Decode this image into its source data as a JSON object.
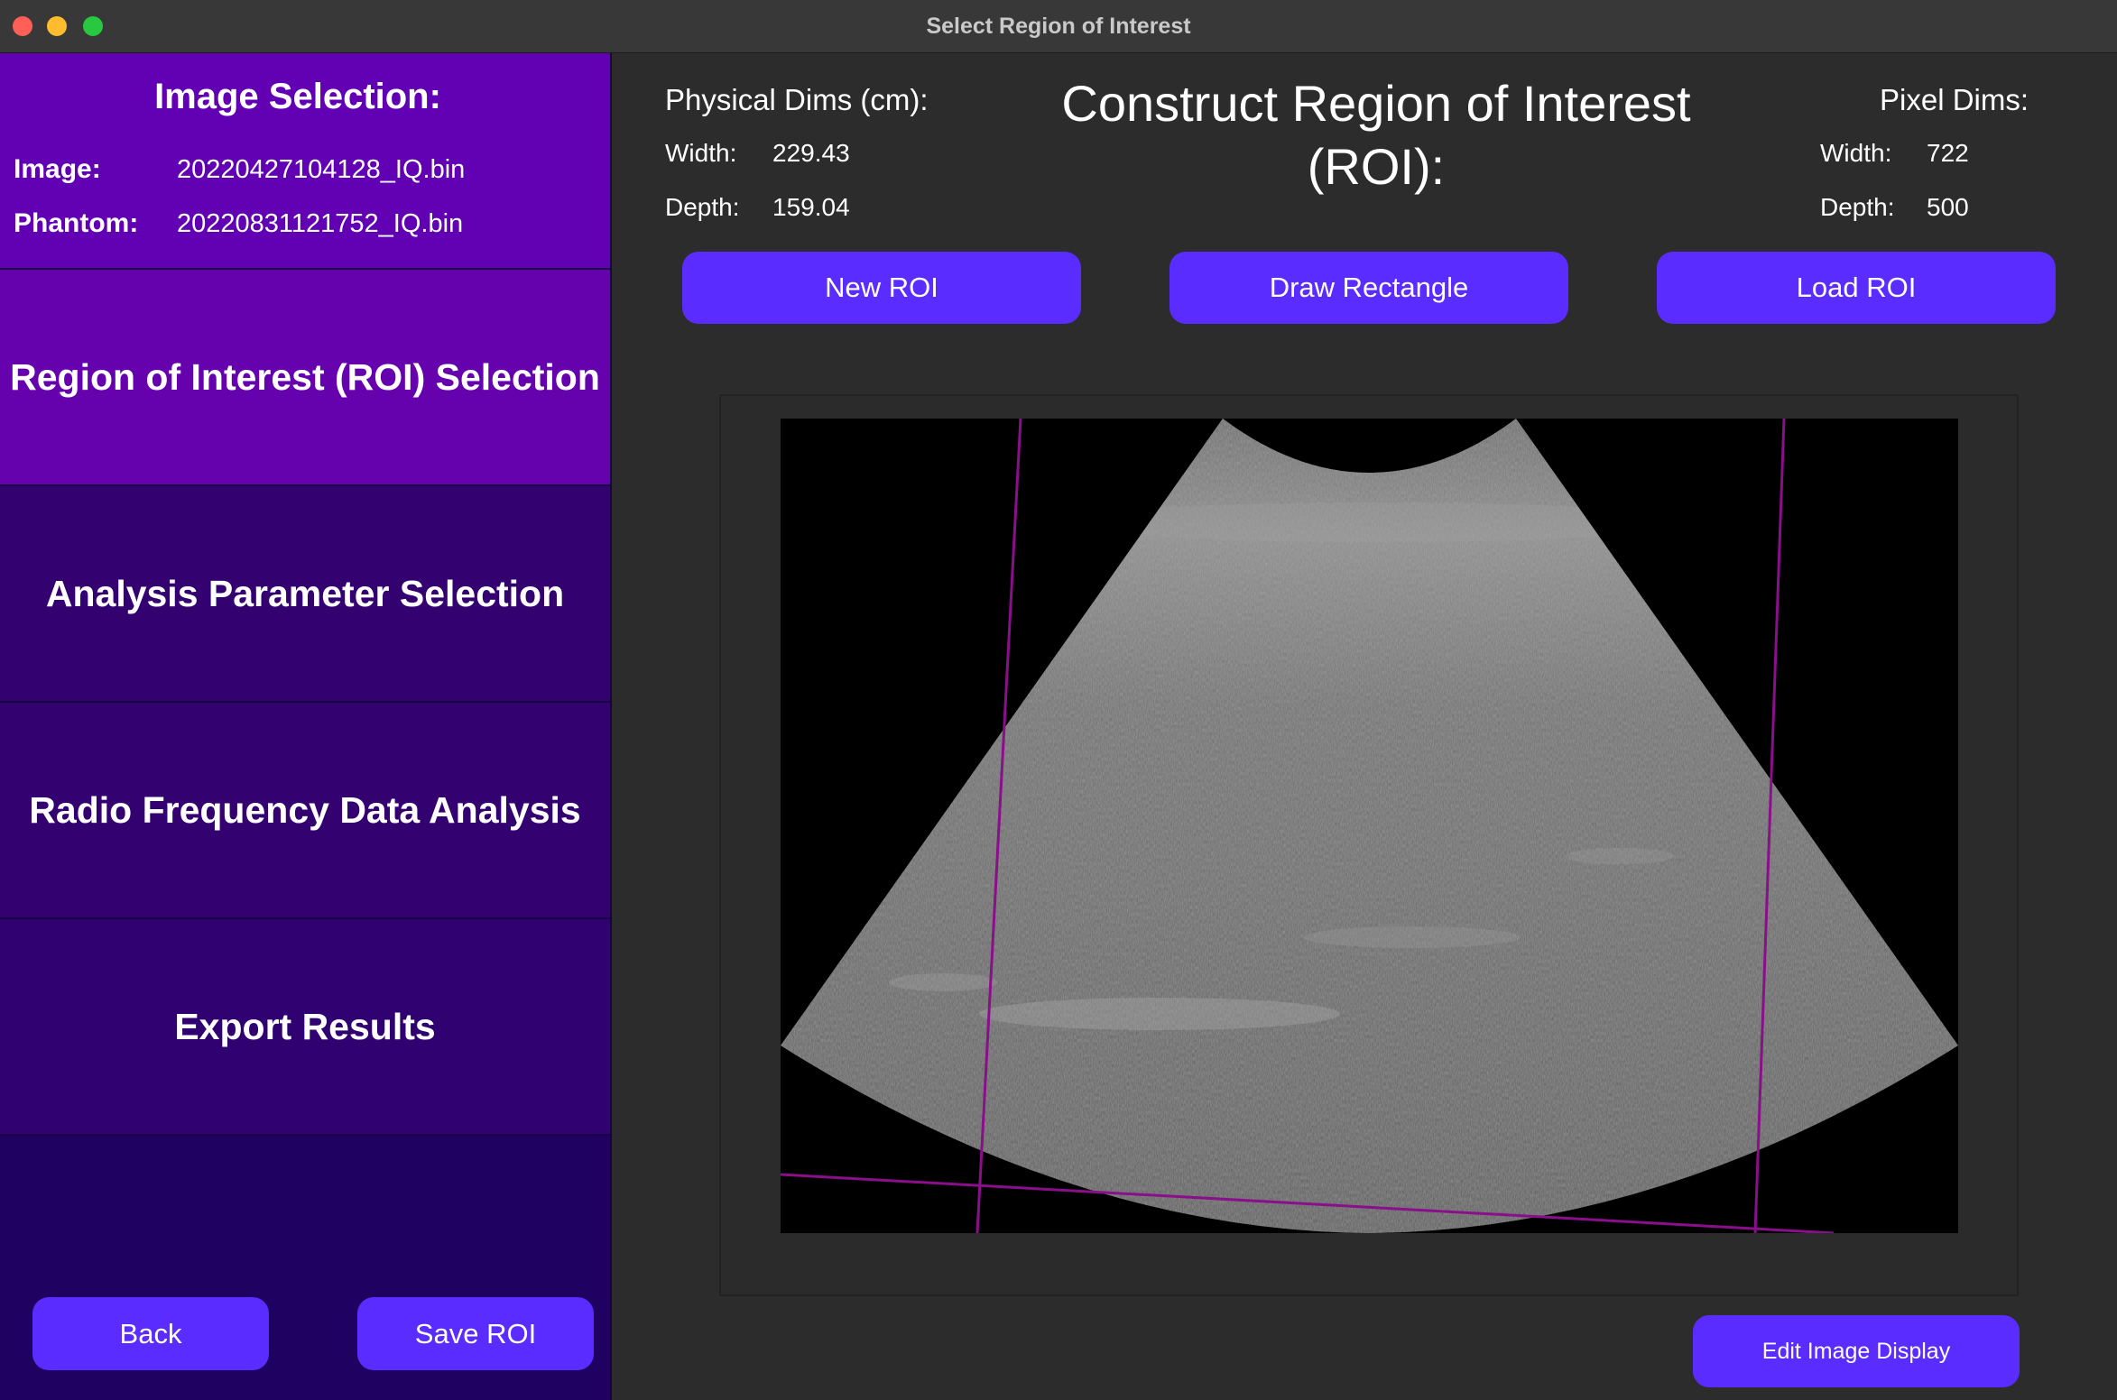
{
  "window": {
    "title": "Select Region of Interest"
  },
  "sidebar": {
    "image_selection": {
      "title": "Image Selection:",
      "image_label": "Image:",
      "image_value": "20220427104128_IQ.bin",
      "phantom_label": "Phantom:",
      "phantom_value": "20220831121752_IQ.bin"
    },
    "nav": [
      {
        "label": "Region of Interest (ROI) Selection"
      },
      {
        "label": "Analysis Parameter Selection"
      },
      {
        "label": "Radio Frequency Data Analysis"
      },
      {
        "label": "Export Results"
      }
    ],
    "back_label": "Back",
    "save_label": "Save ROI"
  },
  "main": {
    "title": "Construct Region of Interest (ROI):",
    "physical": {
      "heading": "Physical Dims (cm):",
      "width_label": "Width:",
      "width_value": "229.43",
      "depth_label": "Depth:",
      "depth_value": "159.04"
    },
    "pixel": {
      "heading": "Pixel Dims:",
      "width_label": "Width:",
      "width_value": "722",
      "depth_label": "Depth:",
      "depth_value": "500"
    },
    "buttons": {
      "new_roi": "New ROI",
      "draw_rectangle": "Draw Rectangle",
      "load_roi": "Load ROI",
      "edit_display": "Edit Image Display"
    }
  },
  "colors": {
    "accent_button": "#5a2cff",
    "sidebar_active": "#6201b3",
    "sidebar_inactive": "#330170",
    "roi_line": "#8a0f8a"
  }
}
